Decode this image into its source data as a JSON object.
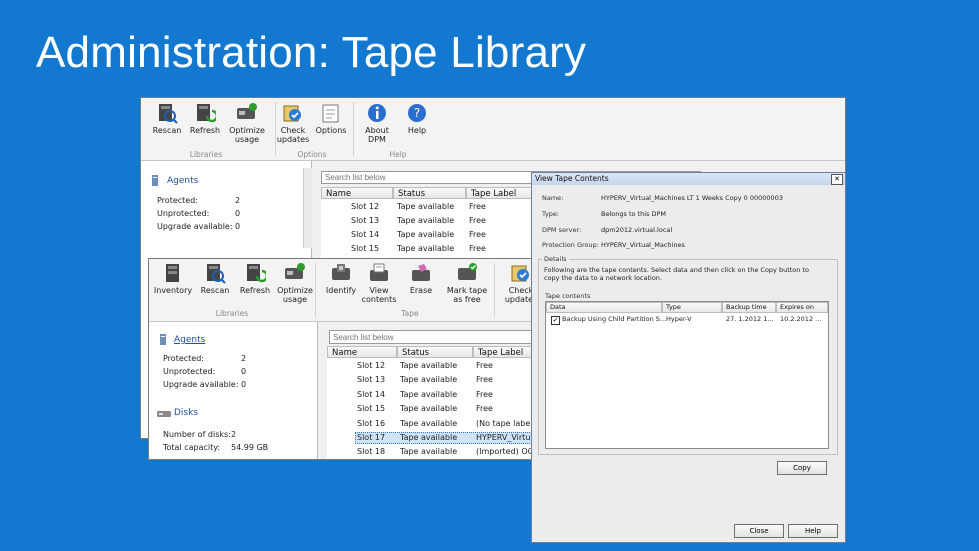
{
  "slide": {
    "title": "Administration: Tape Library"
  },
  "back_window": {
    "ribbon": {
      "buttons": [
        {
          "label": "Rescan",
          "icon": "rescan-icon"
        },
        {
          "label": "Refresh",
          "icon": "refresh-icon"
        },
        {
          "label": "Optimize usage",
          "icon": "optimize-icon"
        },
        {
          "label": "Check updates",
          "icon": "check-updates-icon"
        },
        {
          "label": "Options",
          "icon": "options-icon"
        },
        {
          "label": "About DPM",
          "icon": "info-icon"
        },
        {
          "label": "Help",
          "icon": "help-icon"
        }
      ],
      "groups": [
        "Libraries",
        "Options",
        "Help"
      ]
    },
    "nav": {
      "agents_header": "Agents",
      "rows": [
        {
          "label": "Protected:",
          "value": "2"
        },
        {
          "label": "Unprotected:",
          "value": "0"
        },
        {
          "label": "Upgrade available:",
          "value": "0"
        }
      ]
    },
    "search_placeholder": "Search list below",
    "columns": [
      "Name",
      "Status",
      "Tape Label"
    ],
    "rows": [
      {
        "name": "Slot 12",
        "status": "Tape available",
        "label": "Free"
      },
      {
        "name": "Slot 13",
        "status": "Tape available",
        "label": "Free"
      },
      {
        "name": "Slot 14",
        "status": "Tape available",
        "label": "Free"
      },
      {
        "name": "Slot 15",
        "status": "Tape available",
        "label": "Free"
      }
    ]
  },
  "front_window": {
    "ribbon": {
      "buttons": [
        {
          "label": "Inventory",
          "icon": "inventory-icon"
        },
        {
          "label": "Rescan",
          "icon": "rescan-icon"
        },
        {
          "label": "Refresh",
          "icon": "refresh-icon"
        },
        {
          "label": "Optimize usage",
          "icon": "optimize-icon"
        },
        {
          "label": "Identify",
          "icon": "identify-icon"
        },
        {
          "label": "View contents",
          "icon": "view-contents-icon"
        },
        {
          "label": "Erase",
          "icon": "erase-icon"
        },
        {
          "label": "Mark tape as free",
          "icon": "mark-free-icon"
        },
        {
          "label": "Check updates",
          "icon": "check-updates-icon"
        }
      ],
      "groups": [
        "Libraries",
        "Tape"
      ]
    },
    "nav": {
      "agents_header": "Agents",
      "agent_rows": [
        {
          "label": "Protected:",
          "value": "2"
        },
        {
          "label": "Unprotected:",
          "value": "0"
        },
        {
          "label": "Upgrade available:",
          "value": "0"
        }
      ],
      "disks_header": "Disks",
      "disk_rows": [
        {
          "label": "Number of disks:",
          "value": "2"
        },
        {
          "label": "Total capacity:",
          "value": "54.99 GB"
        }
      ]
    },
    "search_placeholder": "Search list below",
    "columns": [
      "Name",
      "Status",
      "Tape Label"
    ],
    "rows": [
      {
        "name": "Slot 12",
        "status": "Tape available",
        "label": "Free"
      },
      {
        "name": "Slot 13",
        "status": "Tape available",
        "label": "Free"
      },
      {
        "name": "Slot 14",
        "status": "Tape available",
        "label": "Free"
      },
      {
        "name": "Slot 15",
        "status": "Tape available",
        "label": "Free"
      },
      {
        "name": "Slot 16",
        "status": "Tape available",
        "label": "(No tape label"
      },
      {
        "name": "Slot 17",
        "status": "Tape available",
        "label": "HYPERV_Virtu"
      },
      {
        "name": "Slot 18",
        "status": "Tape available",
        "label": "(Imported) OOF"
      }
    ],
    "selected_row": "Slot 17"
  },
  "dialog": {
    "title": "View Tape Contents",
    "fields": [
      {
        "label": "Name:",
        "value": "HYPERV_Virtual_Machines LT 1 Weeks Copy 0 00000003"
      },
      {
        "label": "Type:",
        "value": "Belongs to this DPM"
      },
      {
        "label": "DPM server:",
        "value": "dpm2012.virtual.local"
      },
      {
        "label": "Protection Group:",
        "value": "HYPERV_Virtual_Machines"
      }
    ],
    "details_legend": "Details",
    "details_text": "Following are the tape contents. Select data and then click on the Copy button to copy the data to a network location.",
    "contents_legend": "Tape contents",
    "columns": [
      "Data",
      "Type",
      "Backup time",
      "Expires on"
    ],
    "rows": [
      {
        "data": "Backup Using Child Partition S...",
        "type": "Hyper-V",
        "backup": "27. 1.2012 1...",
        "expires": "10.2.2012 ..."
      }
    ],
    "copy_label": "Copy",
    "close_label": "Close",
    "help_label": "Help"
  }
}
